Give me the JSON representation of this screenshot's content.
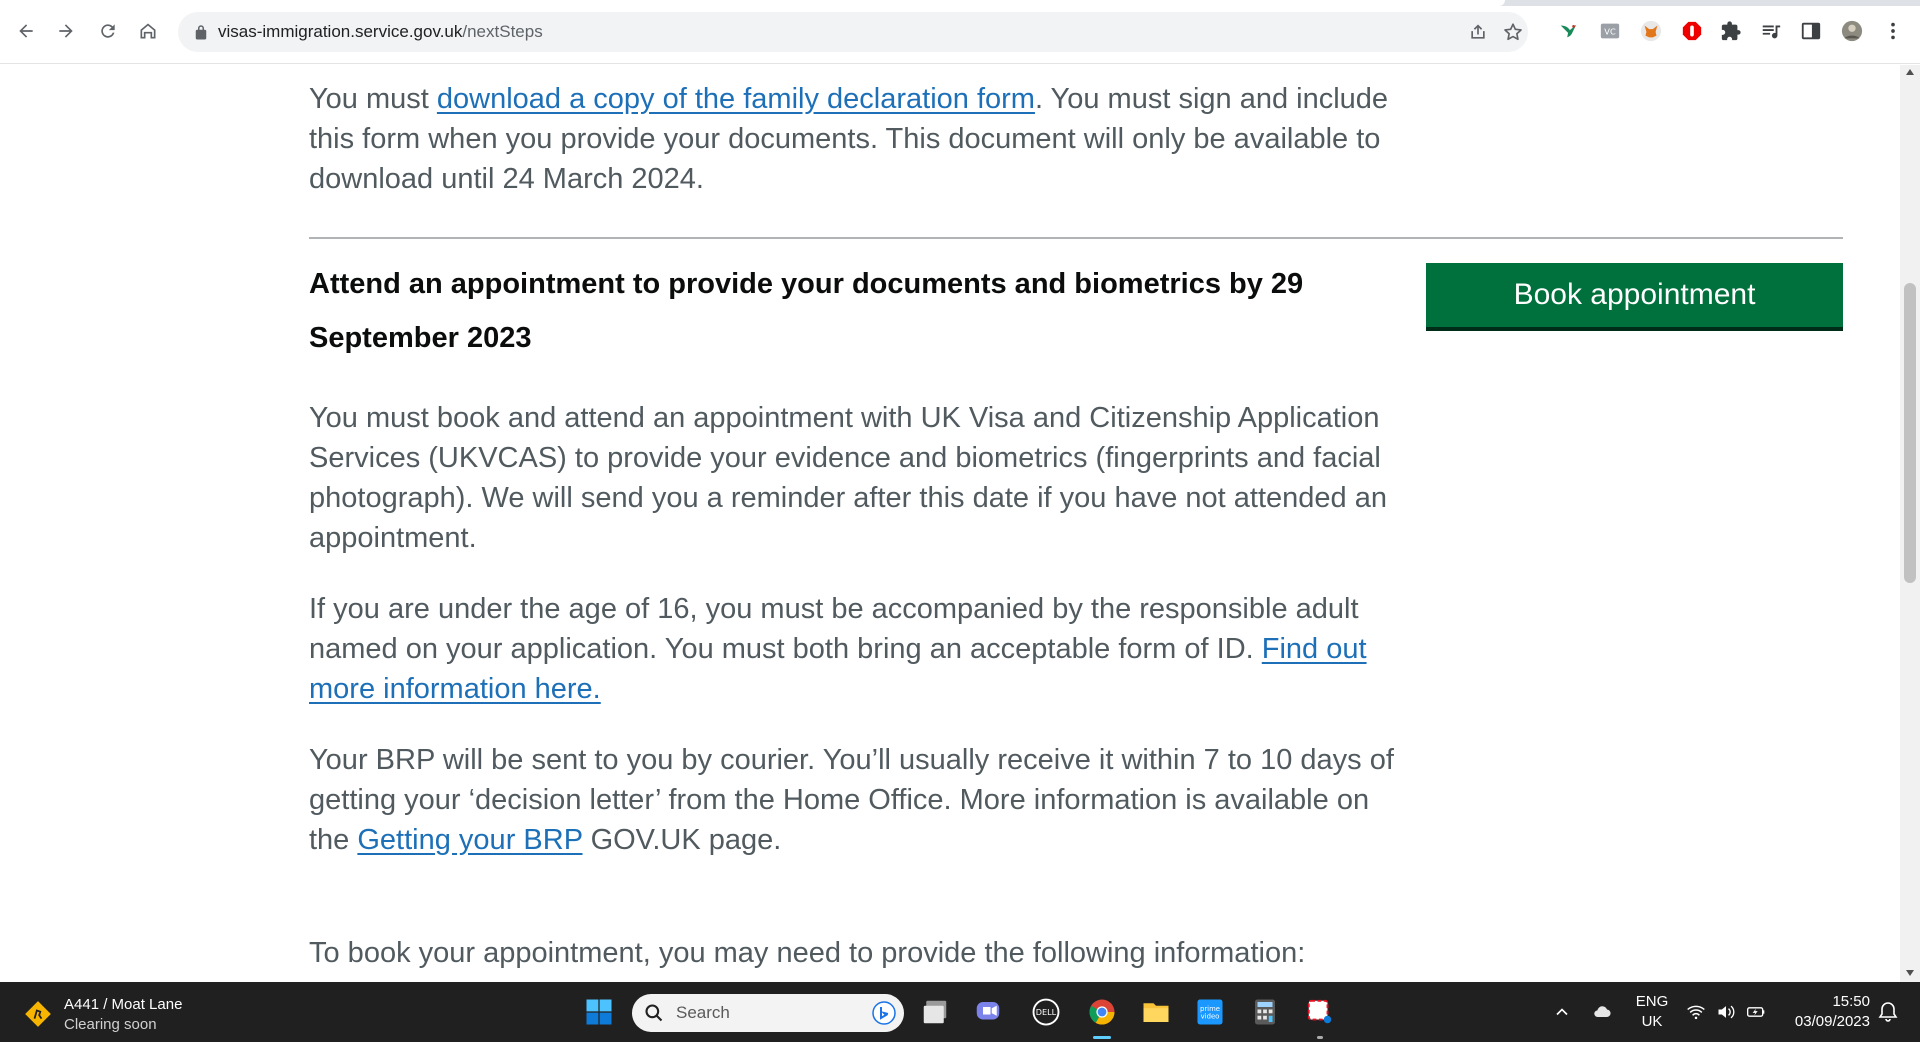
{
  "browser": {
    "url_host": "visas-immigration.service.gov.uk",
    "url_path": "/nextSteps"
  },
  "page": {
    "para1": {
      "before": "You must ",
      "link": "download a copy of the family declaration form",
      "after": ". You must sign and include this form when you provide your documents. This document will only be available to download until 24 March 2024."
    },
    "heading": "Attend an appointment to provide your documents and biometrics by 29 September 2023",
    "book_button": "Book appointment",
    "para2": "You must book and attend an appointment with UK Visa and Citizenship Application Services (UKVCAS) to provide your evidence and biometrics (fingerprints and facial photograph). We will send you a reminder after this date if you have not attended an appointment.",
    "para3": {
      "before": "If you are under the age of 16, you must be accompanied by the responsible adult named on your application. You must both bring an acceptable form of ID. ",
      "link": "Find out more information here."
    },
    "para4": {
      "before": "Your BRP will be sent to you by courier. You’ll usually receive it within 7 to 10 days of getting your ‘decision letter’ from the Home Office. More information is available on the ",
      "link": "Getting your BRP",
      "after": " GOV.UK page."
    },
    "para5": "To book your appointment, you may need to provide the following information:"
  },
  "taskbar": {
    "weather_title": "A441 / Moat Lane",
    "weather_status": "Clearing soon",
    "search_label": "Search",
    "lang_line1": "ENG",
    "lang_line2": "UK",
    "time": "15:50",
    "date": "03/09/2023"
  },
  "colors": {
    "link": "#1d70b8",
    "button_green": "#00703c",
    "body_text": "#505a5f",
    "heading_text": "#0b0c0c",
    "taskbar_bg": "#202020"
  }
}
